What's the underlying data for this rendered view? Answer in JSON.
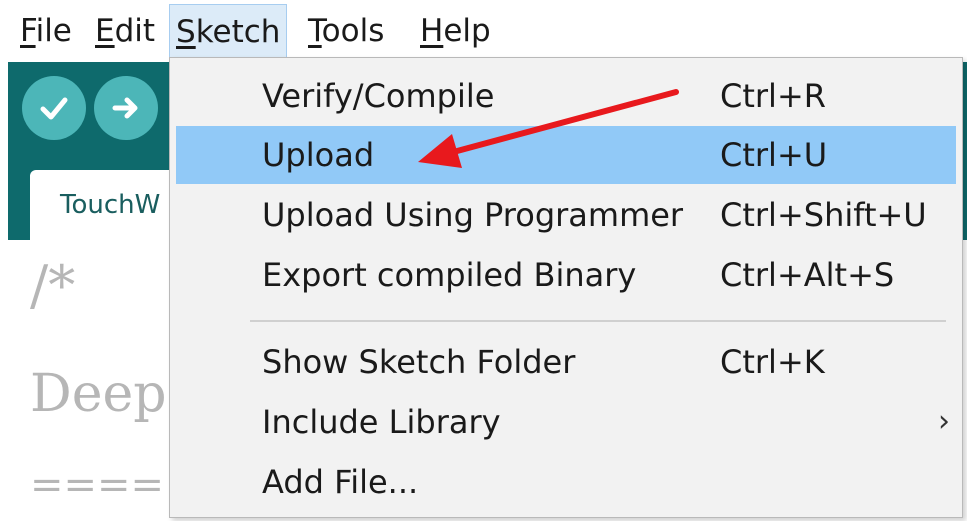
{
  "menubar": {
    "items": [
      {
        "first": "F",
        "rest": "ile"
      },
      {
        "first": "E",
        "rest": "dit"
      },
      {
        "first": "S",
        "rest": "ketch"
      },
      {
        "first": "T",
        "rest": "ools"
      },
      {
        "first": "H",
        "rest": "elp"
      }
    ]
  },
  "toolbar": {
    "verify_icon": "checkmark-icon",
    "upload_icon": "right-arrow-icon"
  },
  "editor": {
    "tab_label": "TouchW",
    "code_lines": [
      "/*",
      "Deep",
      "===="
    ]
  },
  "sketch_menu": {
    "items": [
      {
        "label": "Verify/Compile",
        "shortcut": "Ctrl+R"
      },
      {
        "label": "Upload",
        "shortcut": "Ctrl+U"
      },
      {
        "label": "Upload Using Programmer",
        "shortcut": "Ctrl+Shift+U"
      },
      {
        "label": "Export compiled Binary",
        "shortcut": "Ctrl+Alt+S"
      },
      {
        "label": "Show Sketch Folder",
        "shortcut": "Ctrl+K"
      },
      {
        "label": "Include Library",
        "shortcut": ""
      },
      {
        "label": "Add File...",
        "shortcut": ""
      }
    ],
    "submenu_glyph": "›",
    "highlight_color": "#91c9f7"
  },
  "annotation": {
    "color": "#e8191d"
  }
}
